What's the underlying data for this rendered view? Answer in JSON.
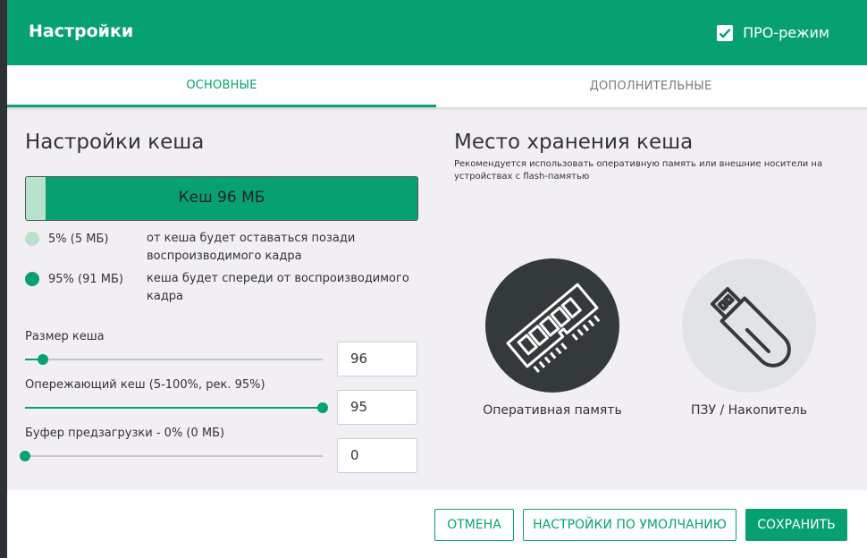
{
  "header": {
    "title": "Настройки",
    "pro_mode_label": "ПРО-режим",
    "pro_mode_checked": true
  },
  "tabs": [
    {
      "label": "ОСНОВНЫЕ",
      "active": true
    },
    {
      "label": "ДОПОЛНИТЕЛЬНЫЕ",
      "active": false
    }
  ],
  "cache": {
    "title": "Настройки кеша",
    "bar_label": "Кеш 96 МБ",
    "back_fraction": 0.05,
    "legend": [
      {
        "value": "5% (5 МБ)",
        "desc": "от кеша будет оставаться позади воспроизводимого кадра",
        "color": "#b8e2cc"
      },
      {
        "value": "95% (91 МБ)",
        "desc": "кеша будет спереди от воспроизводимого кадра",
        "color": "#07a171"
      }
    ],
    "sliders": [
      {
        "label": "Размер кеша",
        "value": "96",
        "fraction": 0.06
      },
      {
        "label": "Опережающий кеш (5-100%, рек. 95%)",
        "value": "95",
        "fraction": 1.0
      },
      {
        "label": "Буфер предзагрузки - 0% (0 МБ)",
        "value": "0",
        "fraction": 0.0
      }
    ]
  },
  "storage": {
    "title": "Место хранения кеша",
    "hint": "Рекомендуется использовать оперативную память или внешние носители на устройствах с flash-памятью",
    "options": [
      {
        "label": "Оперативная память",
        "icon": "ram-icon",
        "selected": true
      },
      {
        "label": "ПЗУ / Накопитель",
        "icon": "usb-drive-icon",
        "selected": false
      }
    ]
  },
  "footer": {
    "cancel_label": "ОТМЕНА",
    "defaults_label": "НАСТРОЙКИ ПО УМОЛЧАНИЮ",
    "save_label": "СОХРАНИТЬ"
  },
  "colors": {
    "accent": "#07a171",
    "accent_light": "#b8e2cc",
    "selected_circle": "#343a3a",
    "unselected_circle": "#e1e3e6"
  }
}
